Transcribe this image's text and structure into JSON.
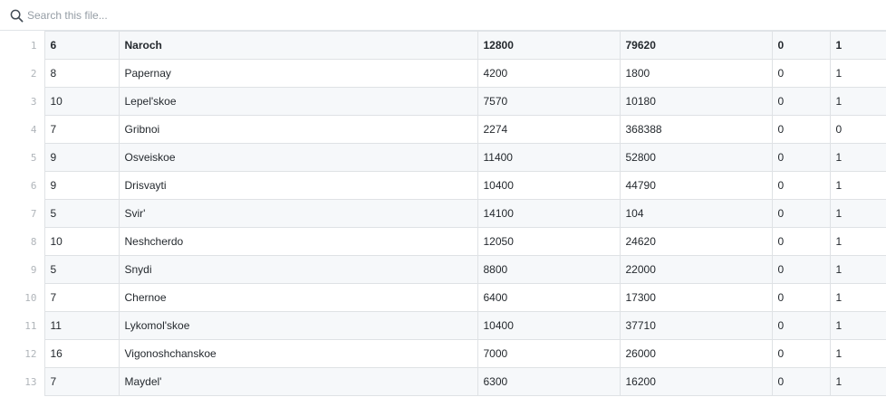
{
  "search": {
    "placeholder": "Search this file..."
  },
  "table": {
    "rows": [
      {
        "line": "1",
        "cells": [
          "6",
          "Naroch",
          "12800",
          "79620",
          "0",
          "1"
        ]
      },
      {
        "line": "2",
        "cells": [
          "8",
          "Papernay",
          "4200",
          "1800",
          "0",
          "1"
        ]
      },
      {
        "line": "3",
        "cells": [
          "10",
          "Lepel'skoe",
          "7570",
          "10180",
          "0",
          "1"
        ]
      },
      {
        "line": "4",
        "cells": [
          "7",
          "Gribnoi",
          "2274",
          "368388",
          "0",
          "0"
        ]
      },
      {
        "line": "5",
        "cells": [
          "9",
          "Osveiskoe",
          "11400",
          "52800",
          "0",
          "1"
        ]
      },
      {
        "line": "6",
        "cells": [
          "9",
          "Drisvayti",
          "10400",
          "44790",
          "0",
          "1"
        ]
      },
      {
        "line": "7",
        "cells": [
          "5",
          "Svir'",
          "14100",
          "104",
          "0",
          "1"
        ]
      },
      {
        "line": "8",
        "cells": [
          "10",
          "Neshcherdo",
          "12050",
          "24620",
          "0",
          "1"
        ]
      },
      {
        "line": "9",
        "cells": [
          "5",
          "Snydi",
          "8800",
          "22000",
          "0",
          "1"
        ]
      },
      {
        "line": "10",
        "cells": [
          "7",
          "Chernoe",
          "6400",
          "17300",
          "0",
          "1"
        ]
      },
      {
        "line": "11",
        "cells": [
          "11",
          "Lykomol'skoe",
          "10400",
          "37710",
          "0",
          "1"
        ]
      },
      {
        "line": "12",
        "cells": [
          "16",
          "Vigonoshchanskoe",
          "7000",
          "26000",
          "0",
          "1"
        ]
      },
      {
        "line": "13",
        "cells": [
          "7",
          "Maydel'",
          "6300",
          "16200",
          "0",
          "1"
        ]
      }
    ]
  }
}
